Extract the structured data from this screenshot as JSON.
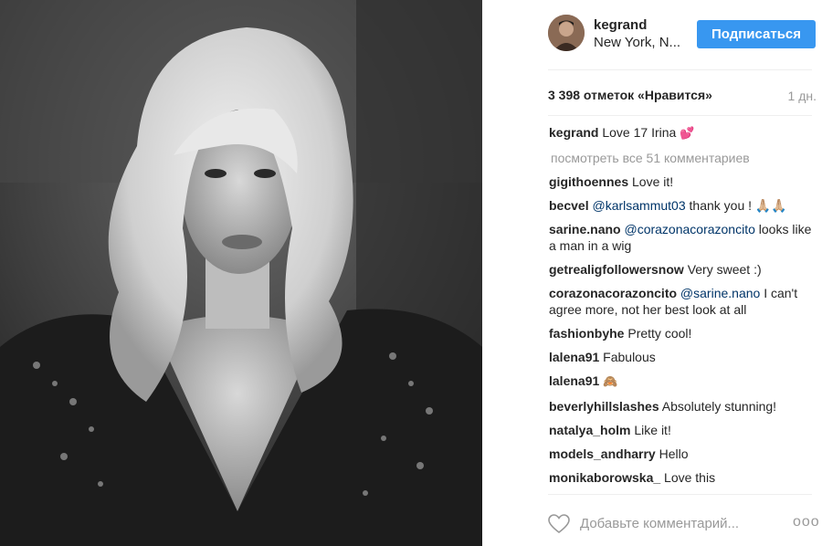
{
  "post": {
    "username": "kegrand",
    "location": "New York, N...",
    "follow_label": "Подписаться",
    "likes": "3 398 отметок «Нравится»",
    "time": "1 дн.",
    "caption_user": "kegrand",
    "caption_text": "Love 17 Irina",
    "caption_emoji": "💕",
    "view_all": "посмотреть все 51 комментариев",
    "comments": [
      {
        "user": "gigithoennes",
        "mention": "",
        "text": "Love it!"
      },
      {
        "user": "becvel",
        "mention": "@karlsammut03",
        "text": "thank you ! 🙏🏼🙏🏼"
      },
      {
        "user": "sarine.nano",
        "mention": "@corazonacorazoncito",
        "text": "looks like a man in a wig"
      },
      {
        "user": "getrealigfollowersnow",
        "mention": "",
        "text": "Very sweet :)"
      },
      {
        "user": "corazonacorazoncito",
        "mention": "@sarine.nano",
        "text": "I can't agree more, not her best look at all"
      },
      {
        "user": "fashionbyhe",
        "mention": "",
        "text": "Pretty cool!"
      },
      {
        "user": "lalena91",
        "mention": "",
        "text": "Fabulous"
      },
      {
        "user": "lalena91",
        "mention": "",
        "text": "🙈"
      },
      {
        "user": "beverlyhillslashes",
        "mention": "",
        "text": "Absolutely stunning!"
      },
      {
        "user": "natalya_holm",
        "mention": "",
        "text": "Like it!"
      },
      {
        "user": "models_andharry",
        "mention": "",
        "text": "Hello"
      },
      {
        "user": "monikaborowska_",
        "mention": "",
        "text": "Love this"
      }
    ],
    "add_comment_placeholder": "Добавьте комментарий...",
    "more_label": "ooo"
  },
  "colors": {
    "accent": "#3897f0",
    "text": "#262626",
    "muted": "#999999",
    "mention": "#003569"
  }
}
